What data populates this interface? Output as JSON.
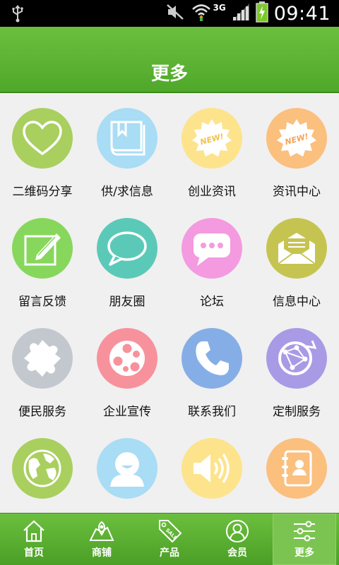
{
  "status": {
    "time": "09:41",
    "network": "3G"
  },
  "header": {
    "title": "更多"
  },
  "grid": [
    {
      "label": "二维码分享",
      "icon": "heart-icon",
      "color": "#a9cf5f"
    },
    {
      "label": "供/求信息",
      "icon": "book-icon",
      "color": "#a9dcf5"
    },
    {
      "label": "创业资讯",
      "icon": "new-badge-icon",
      "color": "#fde38c"
    },
    {
      "label": "资讯中心",
      "icon": "new-badge-icon",
      "color": "#fbbf7e"
    },
    {
      "label": "留言反馈",
      "icon": "note-pencil-icon",
      "color": "#87d75c"
    },
    {
      "label": "朋友圈",
      "icon": "speech-bubble-icon",
      "color": "#5bc9b8"
    },
    {
      "label": "论坛",
      "icon": "chat-dots-icon",
      "color": "#f49ae0"
    },
    {
      "label": "信息中心",
      "icon": "envelope-icon",
      "color": "#c6c451"
    },
    {
      "label": "便民服务",
      "icon": "puzzle-icon",
      "color": "#c3c8cf"
    },
    {
      "label": "企业宣传",
      "icon": "film-reel-icon",
      "color": "#f7929c"
    },
    {
      "label": "联系我们",
      "icon": "phone-icon",
      "color": "#86aee6"
    },
    {
      "label": "定制服务",
      "icon": "globe-network-icon",
      "color": "#a99ae6"
    },
    {
      "label": "",
      "icon": "earth-icon",
      "color": "#a9cf5f"
    },
    {
      "label": "",
      "icon": "smiley-user-icon",
      "color": "#a9dcf5"
    },
    {
      "label": "",
      "icon": "speaker-icon",
      "color": "#fde38c"
    },
    {
      "label": "",
      "icon": "contacts-book-icon",
      "color": "#fbbf7e"
    }
  ],
  "nav": [
    {
      "label": "首页",
      "icon": "home-icon"
    },
    {
      "label": "商铺",
      "icon": "shop-map-icon"
    },
    {
      "label": "产品",
      "icon": "sale-tag-icon"
    },
    {
      "label": "会员",
      "icon": "member-icon"
    },
    {
      "label": "更多",
      "icon": "settings-sliders-icon"
    }
  ]
}
